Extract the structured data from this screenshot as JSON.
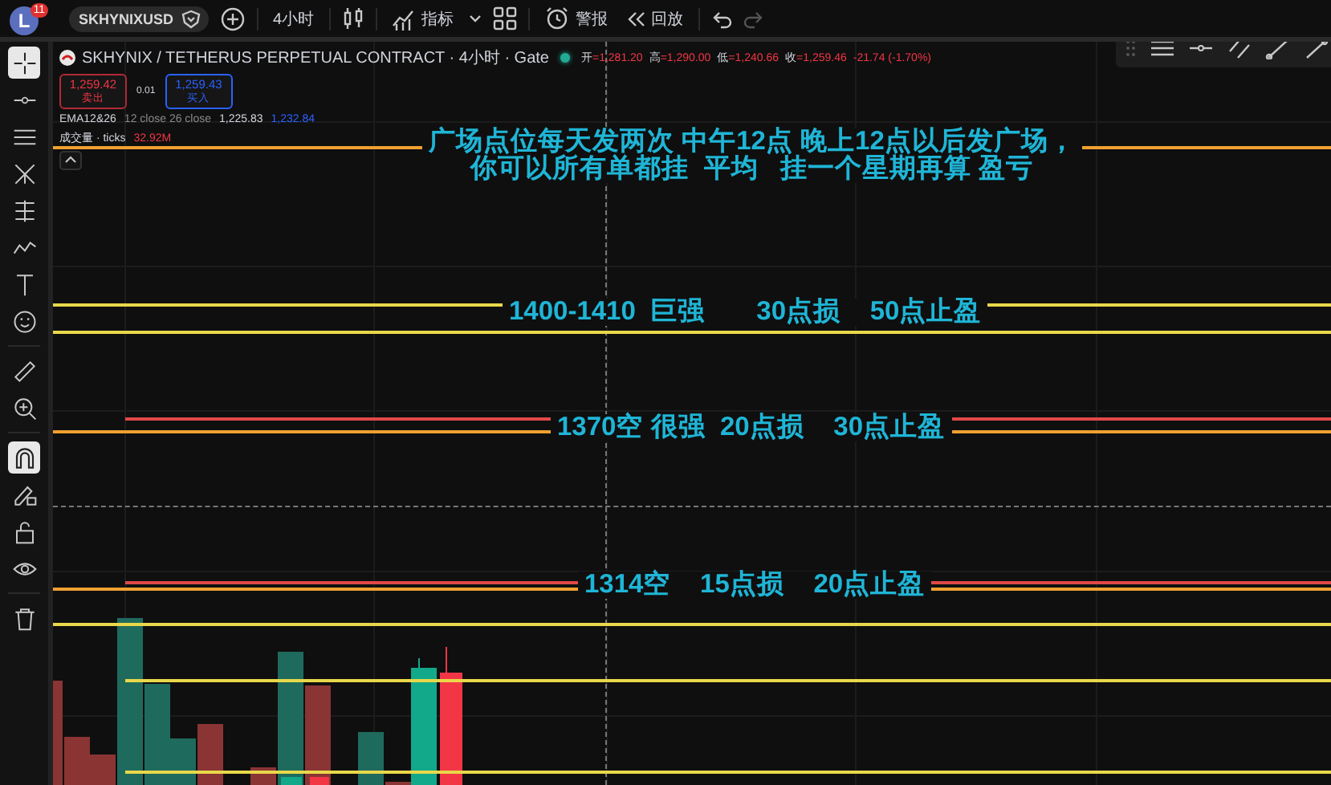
{
  "toolbar": {
    "avatar": {
      "letter": "L",
      "badge": "11"
    },
    "symbol": "SKHYNIXUSD",
    "interval": "4小时",
    "indicators": "指标",
    "alerts": "警报",
    "replay": "回放"
  },
  "left_tools": [
    {
      "selected": true
    },
    {
      "selected": false
    },
    {
      "selected": false
    },
    {
      "selected": false
    },
    {
      "selected": false
    },
    {
      "selected": false
    },
    {
      "selected": false
    },
    {
      "selected": false
    },
    {
      "selected": false
    },
    {
      "selected": false
    },
    {
      "selected": true
    },
    {
      "selected": false
    },
    {
      "selected": false
    },
    {
      "selected": false
    },
    {
      "selected": false
    }
  ],
  "legend": {
    "title": "SKHYNIX / TETHERUS PERPETUAL CONTRACT · 4小时 · Gate",
    "ohlc": [
      {
        "label": "开",
        "value": "=1,281.20"
      },
      {
        "label": "高",
        "value": "=1,290.00"
      },
      {
        "label": "低",
        "value": "=1,240.66"
      },
      {
        "label": "收",
        "value": "=1,259.46"
      }
    ],
    "change": "-21.74 (-1.70%)",
    "sell": {
      "price": "1,259.42",
      "label": "卖出"
    },
    "spread": "0.01",
    "buy": {
      "price": "1,259.43",
      "label": "买入"
    },
    "ema": {
      "name": "EMA12&26",
      "params": "12 close 26 close",
      "values": [
        {
          "text": "1,225.83",
          "color": "#d1d4dc"
        },
        {
          "text": "1,232.84",
          "color": "#2962ff"
        }
      ]
    },
    "volume": {
      "name": "成交量 · ticks",
      "value": "32.92M"
    }
  },
  "lines": [
    {
      "color": "#f0a030"
    },
    {
      "color": "#e8d84a"
    },
    {
      "color": "#e8d84a"
    },
    {
      "color": "#e04848"
    },
    {
      "color": "#f0a030"
    },
    {
      "color": "#e04848"
    },
    {
      "color": "#f0a030"
    },
    {
      "color": "#e8d84a"
    },
    {
      "color": "#e8d84a"
    },
    {
      "color": "#e8d84a"
    }
  ],
  "annotations": [
    {
      "lines": [
        "广场点位每天发两次 中午12点 晚上12点以后发广场，",
        "你可以所有单都挂  平均   挂一个星期再算 盈亏"
      ]
    },
    {
      "lines": [
        "1400-1410  巨强       30点损    50点止盈"
      ]
    },
    {
      "lines": [
        "1370空 很强  20点损    30点止盈"
      ]
    },
    {
      "lines": [
        "1314空    15点损    20点止盈"
      ]
    }
  ]
}
